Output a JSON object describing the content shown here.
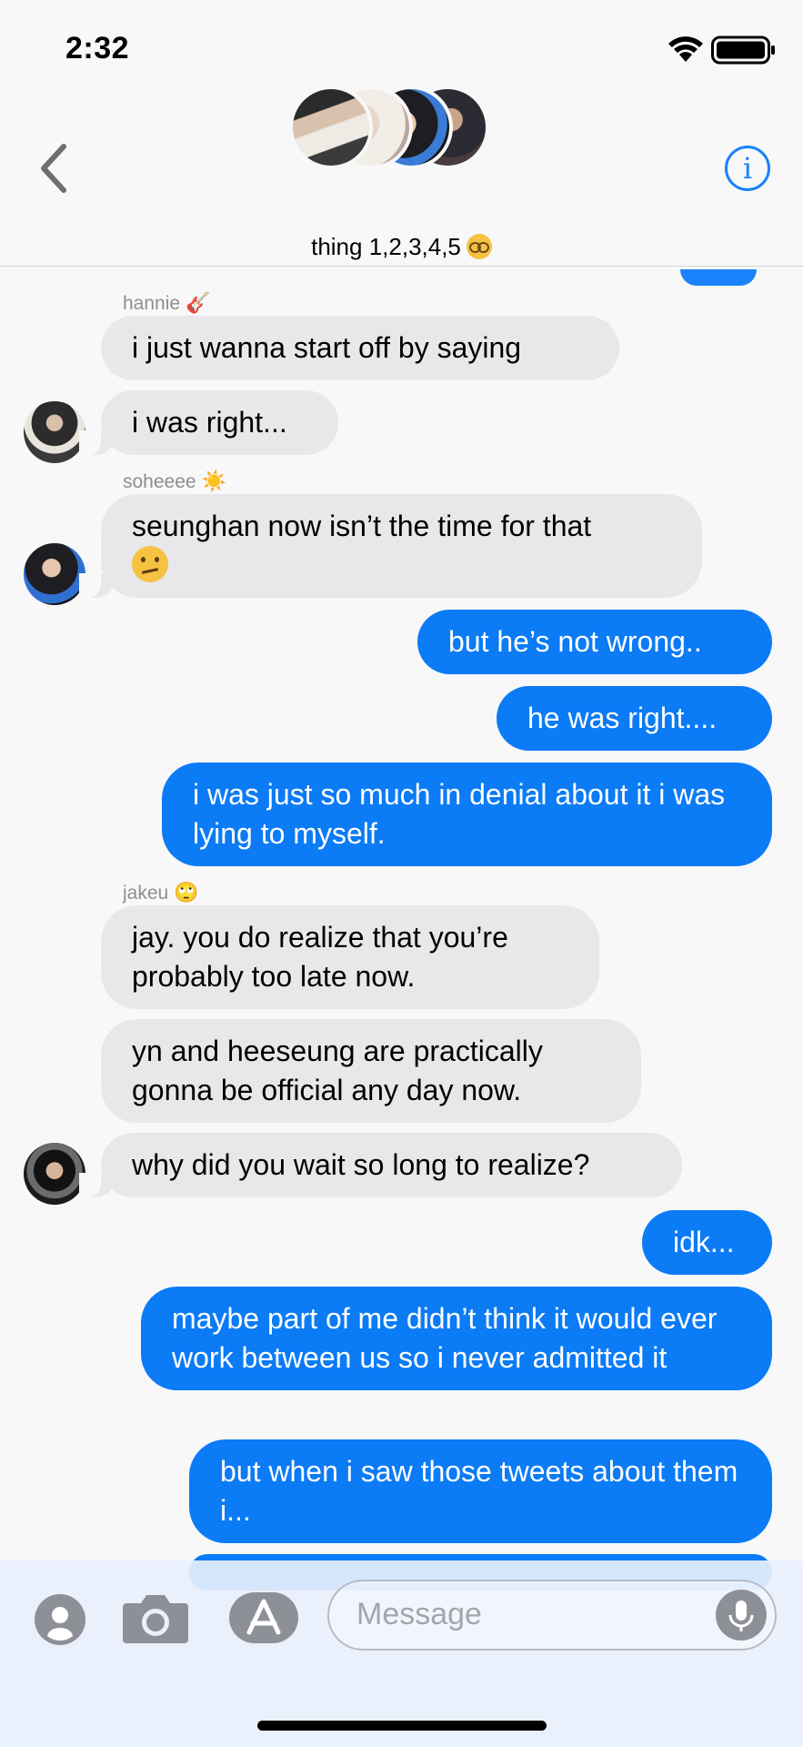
{
  "status_bar": {
    "time": "2:32"
  },
  "header": {
    "title": "thing 1,2,3,4,5",
    "accent_color": "#1a82fb",
    "back_icon": "chevron-left-icon",
    "info_icon": "info-icon",
    "info_glyph": "i"
  },
  "messages": [
    {
      "sender": "hannie",
      "sender_emoji": "🎸",
      "text": "i just wanna start off by saying"
    },
    {
      "text": "i was right..."
    },
    {
      "sender": "soheeee",
      "sender_emoji": "☀️",
      "text": "seunghan now isn’t the time for that"
    },
    {
      "text": "but he’s not wrong.."
    },
    {
      "text": "he was right...."
    },
    {
      "text": "i was just so much in denial about it i was lying to myself."
    },
    {
      "sender": "jakeu",
      "sender_emoji": "🙄",
      "text": "jay. you do realize that you’re probably too late now."
    },
    {
      "text": "yn and heeseung are practically gonna be official any day now."
    },
    {
      "text": "why did you wait so long to realize?"
    },
    {
      "text": "idk..."
    },
    {
      "text": "maybe part of me didn’t think it would ever work between us so i never admitted it"
    },
    {
      "text": "but when i saw those tweets about them i..."
    }
  ],
  "colors": {
    "outgoing": "#0b7bf6",
    "incoming": "#e8e8ea"
  },
  "composer": {
    "placeholder": "Message",
    "icons": [
      "contact-icon",
      "camera-icon",
      "app-store-icon",
      "microphone-icon"
    ]
  }
}
